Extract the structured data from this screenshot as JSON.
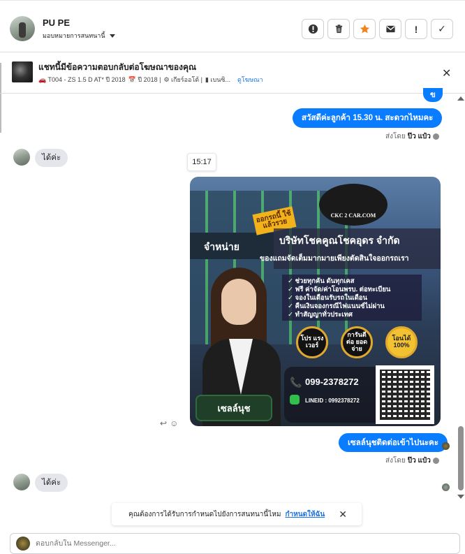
{
  "header": {
    "contact_name": "PU PE",
    "assign_label": "มอบหมายการสนทนานี้",
    "actions": [
      {
        "name": "report-icon",
        "glyph": "!"
      },
      {
        "name": "trash-icon",
        "glyph": ""
      },
      {
        "name": "star-icon",
        "glyph": "★"
      },
      {
        "name": "mail-icon",
        "glyph": ""
      },
      {
        "name": "exclamation-icon",
        "glyph": "!"
      },
      {
        "name": "check-icon",
        "glyph": "✓"
      }
    ]
  },
  "ad_banner": {
    "title": "แชทนี้มีข้อความตอบกลับต่อโฆษณาของคุณ",
    "meta_item1": "🚗 T004 - ZS 1.5 D AT* ปี 2018",
    "meta_item2": "📅 ปี 2018 |",
    "meta_item3": "⚙ เกียร์ออโต้ |",
    "meta_item4": "▮ เบนซิ...",
    "view_ad_link": "ดูโฆษณา"
  },
  "messages": {
    "out1_partial": "ข",
    "out1": "สวัสดีค่ะลูกค้า  15.30  น. สะดวกไหมคะ",
    "sent_by_prefix": "ส่งโดย",
    "sent_by_name": "ป๊ว แป๋ว",
    "in1": "ได้ค่ะ",
    "time_chip": "15:17",
    "out2": "เซลล์นุชติดต่อเข้าไปนะคะ",
    "in2": "ได้ค่ะ"
  },
  "promo_image": {
    "ribbon": "ออกรถนี้ ใช้แล้วรวย",
    "logo": "CKC 2 CAR.COM",
    "sign": "จำหน่าย",
    "company": "บริษัทโชคคูณโชคอุดร จำกัด",
    "tagline": "ของแถมจัดเต็มมากมายเพียงตัดสินใจออกรถเรา",
    "checklist": [
      "✓ ช่วยทุกคัน ดันทุกเคส",
      "✓ ฟรี ค่าจัด/ค่าโอนพรบ. ต่อทะเบียน",
      "✓ จองในเดือนรับรถในเดือน",
      "✓ คืนเงินจองกรณีไฟแนนซ์ไม่ผ่าน",
      "✓ ทำสัญญาทั่วประเทศ"
    ],
    "badge1": "โปร แรง เวอร์",
    "badge2": "การันตี ต่อ ยอดจ่าย",
    "badge3": "โอนได้ 100%",
    "phone": "099-2378272",
    "line_id": "LINEID : 0992378272",
    "sales_tag": "เซลล์นุช"
  },
  "notice": {
    "text": "คุณต้องการได้รับการกำหนดไปยังการสนทนานี้ไหม",
    "link": "กำหนดให้ฉัน"
  },
  "composer": {
    "placeholder": "ตอบกลับใน Messenger..."
  },
  "colors": {
    "accent": "#0a7cff",
    "star": "#f4811f",
    "link": "#1b74e4"
  }
}
